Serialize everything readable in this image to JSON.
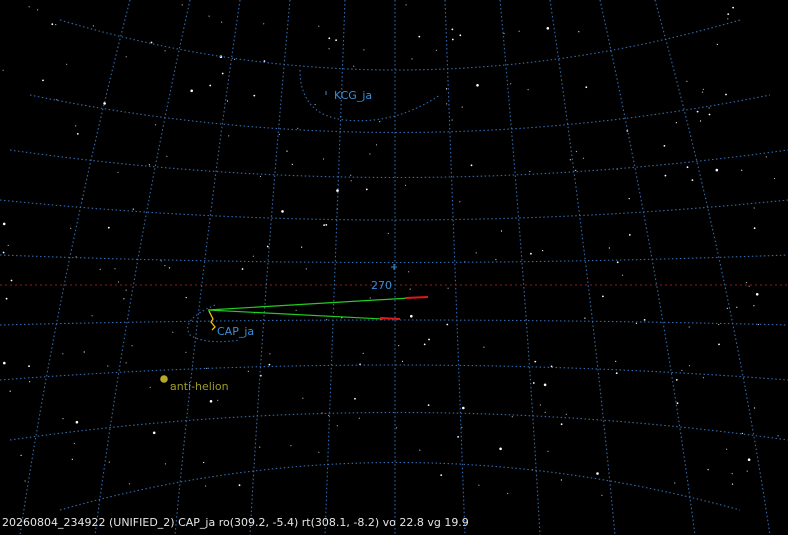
{
  "labels": {
    "radiant": "KCG_ja",
    "azimuth": "270",
    "station": "CAP_ja",
    "antihelion": "anti-helion"
  },
  "status": {
    "text": "20260804_234922 (UNIFIED_2) CAP_ja ro(309.2, -5.4) rt(308.1, -8.2) vo 22.8 vg 19.9"
  },
  "colors": {
    "background": "#000000",
    "grid": "#3a78c0",
    "horizon": "#8a1f1f",
    "track": "#22cc22",
    "track_end": "#e01818",
    "label": "#3a8fd6",
    "antihelion": "#9a9a2a",
    "station_marker": "#f0c000"
  }
}
